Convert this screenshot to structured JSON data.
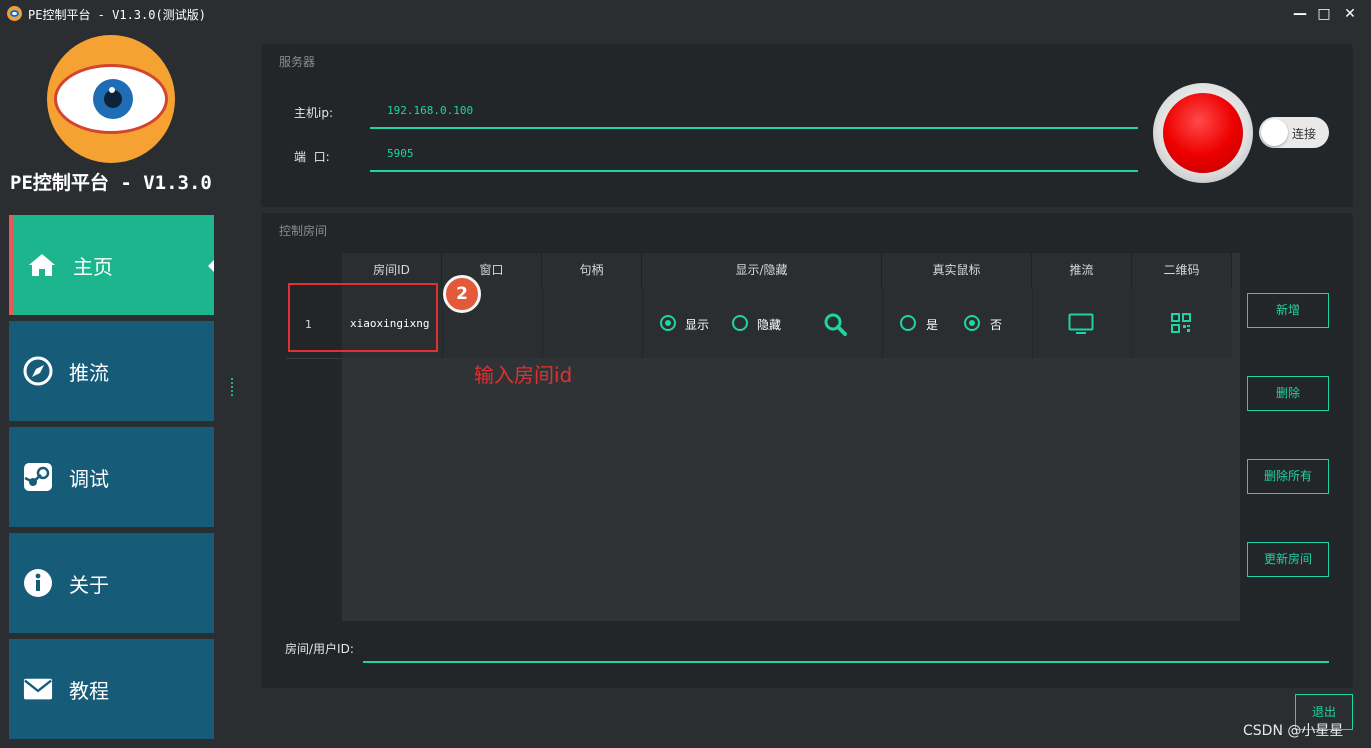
{
  "window": {
    "title": "PE控制平台 - V1.3.0(测试版)",
    "minimize": "—",
    "maximize": "□",
    "close": "✕"
  },
  "sidebar": {
    "app_name": "PE控制平台 - V1.3.0",
    "items": [
      {
        "label": "主页",
        "icon": "home-icon",
        "active": true
      },
      {
        "label": "推流",
        "icon": "compass-icon",
        "active": false
      },
      {
        "label": "调试",
        "icon": "steam-icon",
        "active": false
      },
      {
        "label": "关于",
        "icon": "info-icon",
        "active": false
      },
      {
        "label": "教程",
        "icon": "envelope-icon",
        "active": false
      }
    ]
  },
  "server": {
    "title": "服务器",
    "host_label": "主机ip:",
    "host_value": "192.168.0.100",
    "port_label": "端  口:",
    "port_value": "5905",
    "connect_label": "连接",
    "status_color": "#ee0000"
  },
  "rooms": {
    "title": "控制房间",
    "columns": [
      "房间ID",
      "窗口",
      "句柄",
      "显示/隐藏",
      "真实鼠标",
      "推流",
      "二维码"
    ],
    "row": {
      "index": "1",
      "room_id": "xiaoxingixng",
      "window": "",
      "handle": "",
      "show_label": "显示",
      "hide_label": "隐藏",
      "show_selected": true,
      "real_mouse_yes": "是",
      "real_mouse_no": "否",
      "real_mouse_selected": "否"
    },
    "buttons": {
      "add": "新增",
      "delete": "删除",
      "delete_all": "删除所有",
      "update": "更新房间"
    },
    "user_id_label": "房间/用户ID:",
    "user_id_value": ""
  },
  "annotation": {
    "badge": "2",
    "text": "输入房间id"
  },
  "exit_label": "退出",
  "watermark": "CSDN @小星星",
  "colors": {
    "accent": "#1ed3a4",
    "nav_active": "#1db58e",
    "nav_item": "#165b78",
    "annotation": "#e03030"
  }
}
